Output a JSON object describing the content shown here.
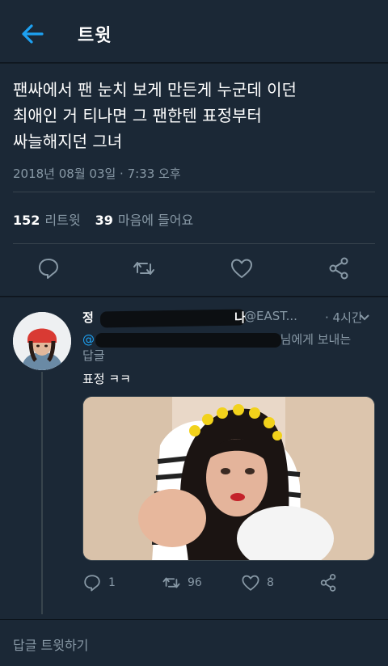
{
  "header": {
    "title": "트윗",
    "back_icon": "arrow-left-icon",
    "accent": "#1da1f2"
  },
  "tweet": {
    "lines": [
      "팬싸에서 팬 눈치 보게 만든게 누군데 이던",
      "최애인 거 티나면 그 팬한텐 표정부터",
      "싸늘해지던 그녀"
    ],
    "timestamp": "2018년 08월 03일 · 7:33 오후",
    "retweets_count": "152",
    "retweets_label": "리트윗",
    "likes_count": "39",
    "likes_label": "마음에 들어요"
  },
  "reply": {
    "name_start": "정",
    "name_end": "나",
    "handle": "@EAST...",
    "age": "· 4시간",
    "replying_to": "@",
    "replying_suffix": "님에게 보내는",
    "replying_line2": "답글",
    "text": "표정 ㅋㅋ",
    "reply_count": "1",
    "retweet_count": "96",
    "like_count": "8"
  },
  "compose": {
    "placeholder": "답글 트윗하기"
  },
  "colors": {
    "background": "#141d26",
    "panel": "#1b2836",
    "muted": "#8899a6",
    "accent": "#1da1f2"
  }
}
